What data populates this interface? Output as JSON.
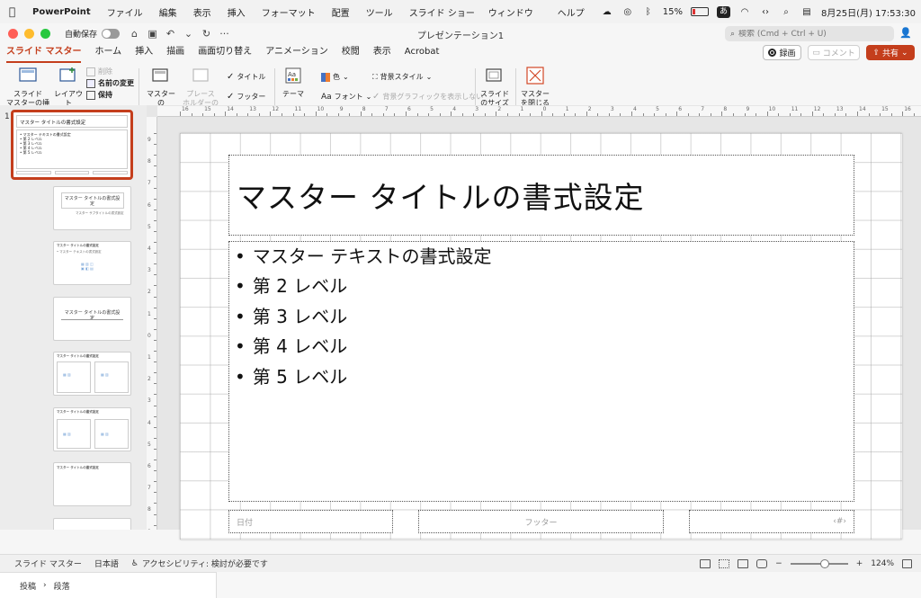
{
  "menubar": {
    "app": "PowerPoint",
    "items": [
      "ファイル",
      "編集",
      "表示",
      "挿入",
      "フォーマット",
      "配置",
      "ツール",
      "スライド ショー",
      "ウィンドウ",
      "ヘルプ"
    ],
    "battery": "15%",
    "ime": "あ",
    "datetime": "8月25日(月)  17:53:30"
  },
  "titlebar": {
    "autosave_label": "自動保存",
    "doc_title": "プレゼンテーション1",
    "search_placeholder": "検索 (Cmd + Ctrl + U)"
  },
  "tabs": [
    "スライド マスター",
    "ホーム",
    "挿入",
    "描画",
    "画面切り替え",
    "アニメーション",
    "校閲",
    "表示",
    "Acrobat"
  ],
  "actions": {
    "record": "録画",
    "comment": "コメント",
    "share": "共有"
  },
  "ribbon": {
    "insert_master": "スライド\nマスターの挿入",
    "insert_layout": "レイアウト\nの挿入",
    "delete": "削除",
    "rename": "名前の変更",
    "preserve": "保持",
    "master_layout": "マスターの\nレイアウト",
    "insert_placeholder": "プレース\nホルダーの挿入",
    "title_check": "タイトル",
    "footer_check": "フッター",
    "theme": "テーマ",
    "colors": "色",
    "fonts": "フォント",
    "bg_styles": "背景スタイル",
    "hide_bg": "背景グラフィックを表示しない",
    "slide_size": "スライド\nのサイズ",
    "close_master": "マスター\nを閉じる"
  },
  "slidepanel": {
    "master_number": "1",
    "master_title": "マスター タイトルの書式設定",
    "master_bullets": [
      "• マスター テキストの書式設定",
      "• 第 2 レベル",
      "• 第 3 レベル",
      "• 第 4 レベル",
      "• 第 5 レベル"
    ],
    "layout2_title": "マスター タイトルの書式設定",
    "layout2_sub": "マスター サブタイトルの書式設定",
    "layout3_title": "マスター タイトルの書式設定",
    "layout3_text": "• マスター テキストの書式設定",
    "layout4_title": "マスター タイトルの書式設定",
    "layout5_title": "マスター タイトルの書式設定",
    "layout6_title": "マスター タイトルの書式設定",
    "layout7_title": "マスター タイトルの書式設定"
  },
  "slide": {
    "title": "マスター タイトルの書式設定",
    "bullets": [
      "マスター テキストの書式設定",
      "第 2 レベル",
      "第 3 レベル",
      "第 4 レベル",
      "第 5 レベル"
    ],
    "footer_date": "日付",
    "footer_center": "フッター",
    "footer_page": "‹#›"
  },
  "statusbar": {
    "view": "スライド マスター",
    "language": "日本語",
    "accessibility": "アクセシビリティ: 検討が必要です",
    "zoom": "124%"
  },
  "bottom": {
    "crumb1": "投稿",
    "crumb2": "段落"
  },
  "colors": {
    "accent": "#c43e1c"
  }
}
